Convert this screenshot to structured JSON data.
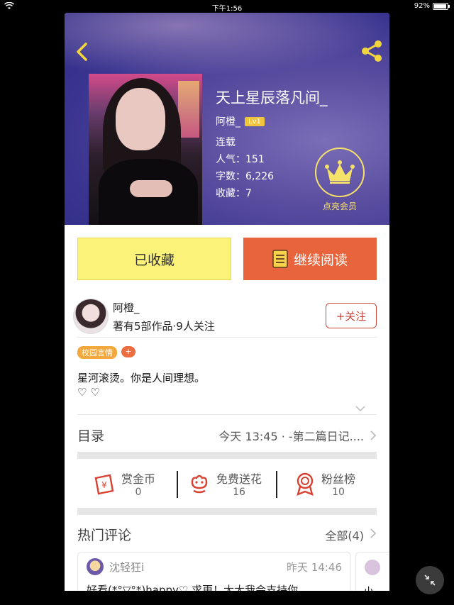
{
  "status_bar": {
    "time": "下午1:56",
    "battery": "92%"
  },
  "hero": {
    "title": "天上星辰落凡间_",
    "author": "阿橙_",
    "level": "Lv1",
    "status": "连载",
    "popularity": "人气：151",
    "word_count": "字数：6,226",
    "favorites": "收藏：7",
    "vip_label": "点亮会员"
  },
  "actions": {
    "favorited": "已收藏",
    "continue_reading": "继续阅读"
  },
  "author_card": {
    "name": "阿橙_",
    "stats": "著有5部作品·9人关注",
    "follow": "+关注"
  },
  "tags": [
    "校园言情"
  ],
  "tag_add": "+",
  "description": {
    "line1": "星河滚烫。你是人间理想。",
    "line2": "♡ ♡"
  },
  "toc": {
    "title": "目录",
    "latest": "今天 13:45 · -第二篇日记...."
  },
  "stats": [
    {
      "label": "赏金币",
      "value": "0"
    },
    {
      "label": "免费送花",
      "value": "16"
    },
    {
      "label": "粉丝榜",
      "value": "10"
    }
  ],
  "comments": {
    "title": "热门评论",
    "all": "全部(4)",
    "items": [
      {
        "user": "沈轻狂i",
        "time": "昨天 14:46",
        "text": "好看(*°▽°*)happy♡ 求更！大大我会支持你"
      },
      {
        "text": "小"
      }
    ]
  },
  "colors": {
    "accent_orange": "#e8643c",
    "favorite_yellow": "#fbf279",
    "follow_red": "#c9463a",
    "vip_gold": "#f6e26a"
  }
}
